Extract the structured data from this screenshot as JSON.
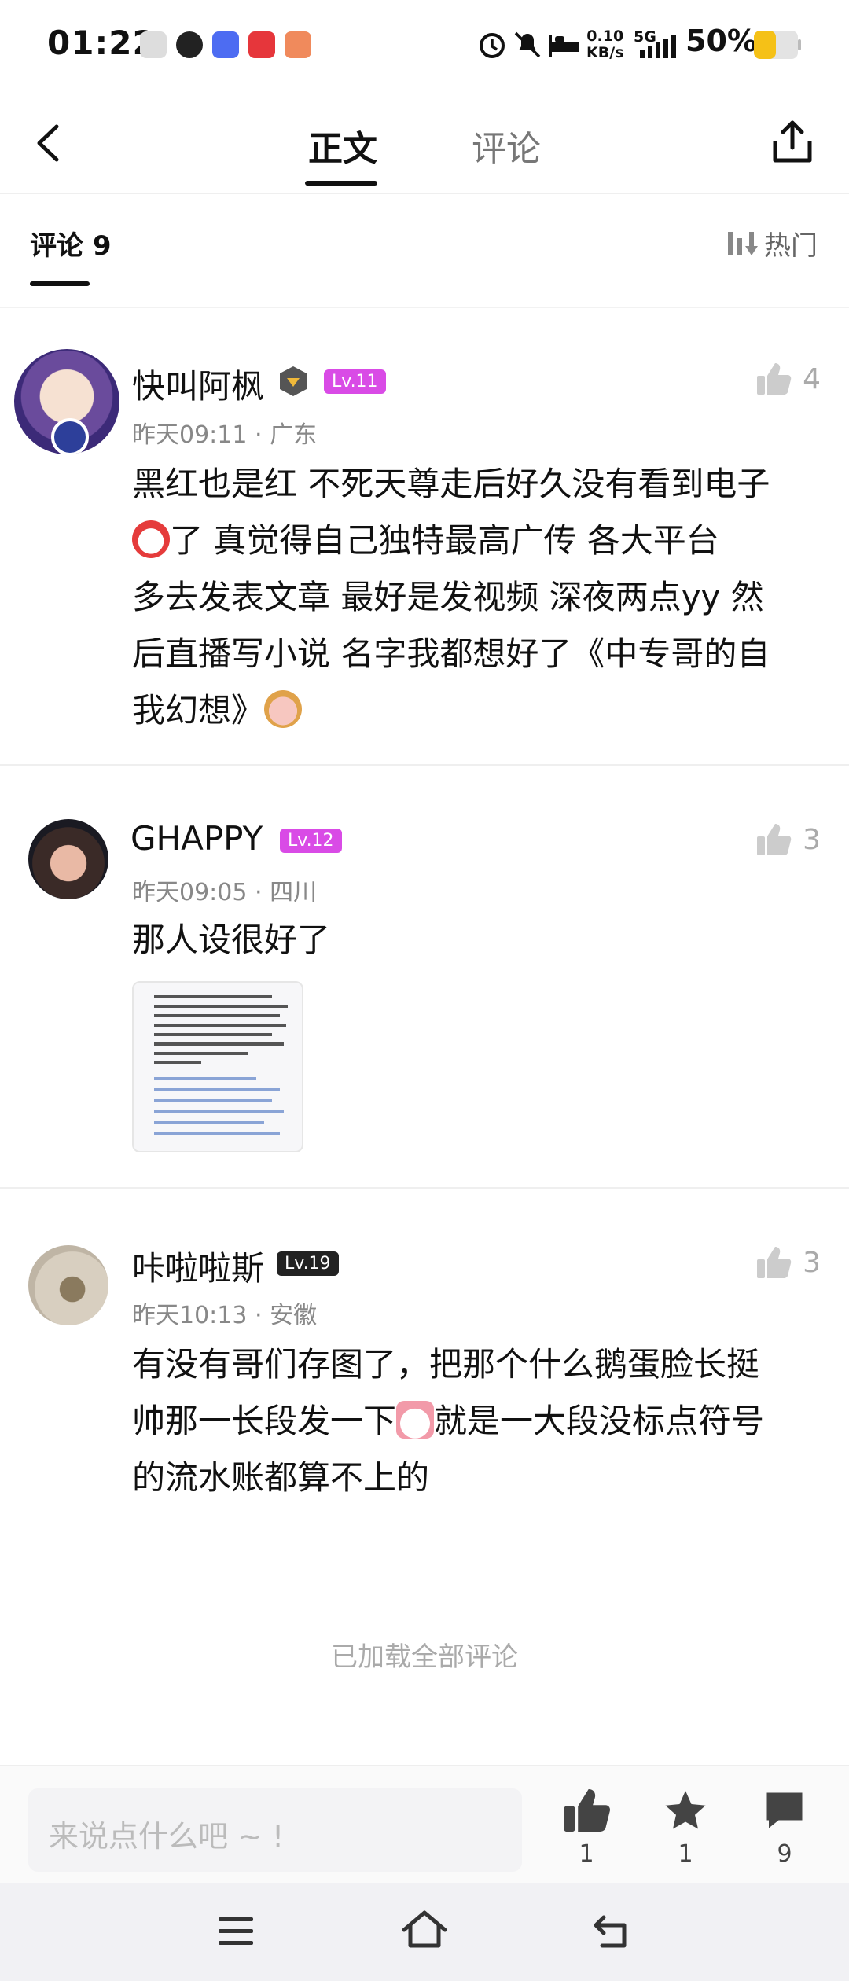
{
  "status_bar": {
    "time": "01:22",
    "speed_top": "0.10",
    "speed_bottom": "KB/s",
    "network": "5G",
    "battery": "50%"
  },
  "nav": {
    "tab_article": "正文",
    "tab_comments": "评论"
  },
  "subheader": {
    "title": "评论 9",
    "sort": "热门"
  },
  "comments": [
    {
      "name": "快叫阿枫",
      "level": "Lv.11",
      "meta": "昨天09:11 · 广东",
      "likes": "4",
      "lines": [
        "黑红也是红 不死天尊走后好久没有看到电子",
        "了  真觉得自己独特最高广传   各大平台",
        "多去发表文章 最好是发视频 深夜两点yy 然",
        "后直播写小说 名字我都想好了《中专哥的自",
        "我幻想》"
      ]
    },
    {
      "name": "GHAPPY",
      "level": "Lv.12",
      "meta": "昨天09:05 · 四川",
      "likes": "3",
      "lines": [
        "那人设很好了"
      ]
    },
    {
      "name": "咔啦啦斯",
      "level": "Lv.19",
      "meta": "昨天10:13 · 安徽",
      "likes": "3",
      "lines": [
        "有没有哥们存图了，把那个什么鹅蛋脸长挺",
        "帅那一长段发一下",
        "就是一大段没标点符号",
        "的流水账都算不上的"
      ]
    }
  ],
  "loaded_all": "已加载全部评论",
  "bottom": {
    "placeholder": "来说点什么吧 ~ !",
    "like_count": "1",
    "fav_count": "1",
    "comment_count": "9"
  },
  "colors": {
    "level_pink": "#d94be6",
    "level_dark": "#222222",
    "icon_gray": "#cccccc",
    "battery": "#f5c117"
  }
}
